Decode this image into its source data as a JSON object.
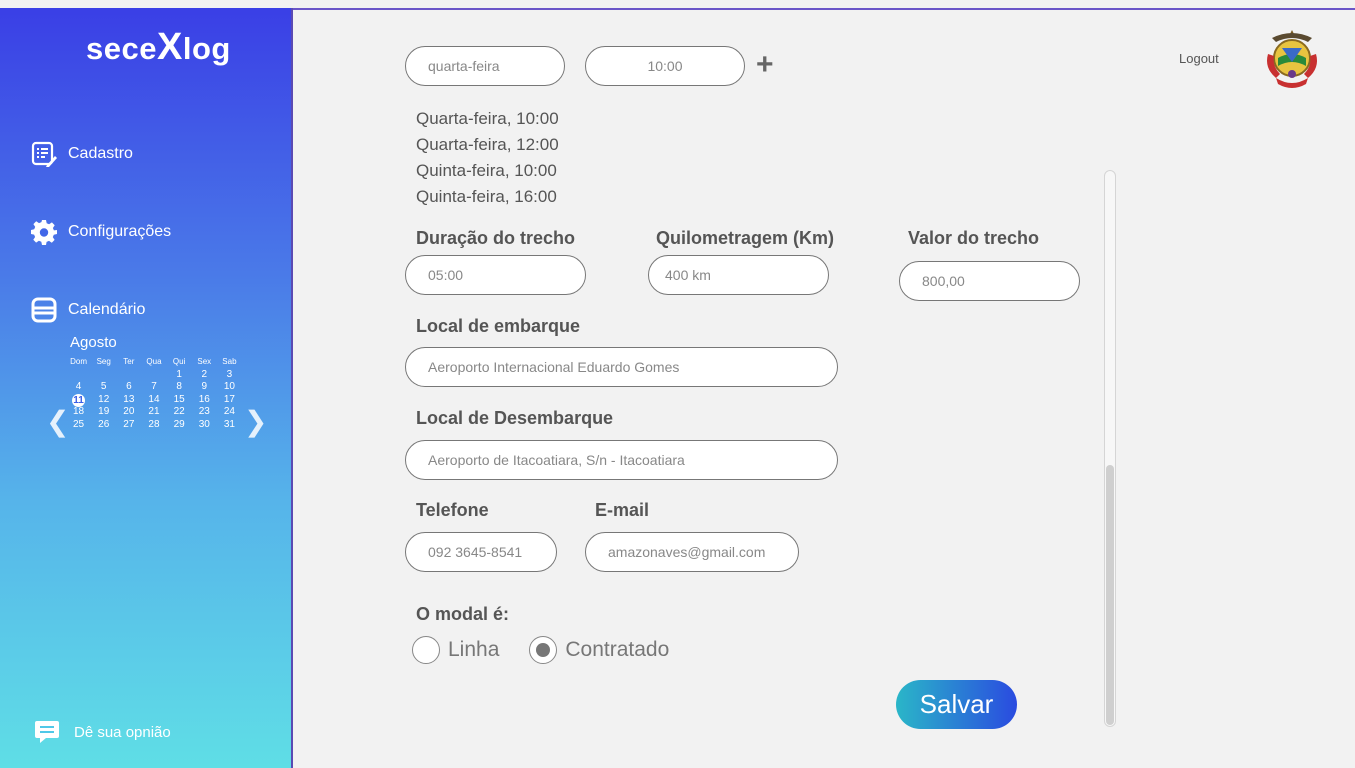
{
  "sidebar": {
    "logo_prefix": "sece",
    "logo_x": "X",
    "logo_suffix": "log",
    "cadastro": "Cadastro",
    "configuracoes": "Configurações",
    "calendario": "Calendário",
    "feedback": "Dê sua opnião"
  },
  "calendar": {
    "month": "Agosto",
    "weekdays": [
      "Dom",
      "Seg",
      "Ter",
      "Qua",
      "Qui",
      "Sex",
      "Sab"
    ],
    "weeks": [
      [
        "",
        "",
        "",
        "",
        "1",
        "2",
        "3"
      ],
      [
        "4",
        "5",
        "6",
        "7",
        "8",
        "9",
        "10"
      ],
      [
        "11",
        "12",
        "13",
        "14",
        "15",
        "16",
        "17"
      ],
      [
        "18",
        "19",
        "20",
        "21",
        "22",
        "23",
        "24"
      ],
      [
        "25",
        "26",
        "27",
        "28",
        "29",
        "30",
        "31"
      ]
    ],
    "today": "11",
    "prev_arrow": "❮",
    "next_arrow": "❯"
  },
  "schedule": {
    "day_value": "quarta-feira",
    "time_value": "10:00",
    "add_symbol": "+",
    "entries": [
      "Quarta-feira, 10:00",
      "Quarta-feira, 12:00",
      "Quinta-feira, 10:00",
      "Quinta-feira, 16:00"
    ]
  },
  "form": {
    "duracao_label": "Duração do trecho",
    "duracao_value": "05:00",
    "quilometragem_label": "Quilometragem (Km)",
    "quilometragem_value": "400 km",
    "valor_label": "Valor do trecho",
    "valor_value": "800,00",
    "embarque_label": "Local de embarque",
    "embarque_value": "Aeroporto Internacional Eduardo Gomes",
    "desembarque_label": "Local de Desembarque",
    "desembarque_value": "Aeroporto de Itacoatiara, S/n - Itacoatiara",
    "telefone_label": "Telefone",
    "telefone_value": "092 3645-8541",
    "email_label": "E-mail",
    "email_value": "amazonaves@gmail.com",
    "modal_label": "O modal é:",
    "modal_options": [
      "Linha",
      "Contratado"
    ],
    "modal_selected": "Contratado",
    "save_label": "Salvar"
  },
  "header": {
    "logout": "Logout"
  },
  "colors": {
    "sidebar_top": "#3a3fe6",
    "sidebar_bottom": "#5fdee6",
    "save_gradient_start": "#2ab6c8",
    "save_gradient_end": "#2a4be0"
  },
  "icons": {
    "cadastro": "clipboard-list-icon",
    "configuracoes": "gear-icon",
    "calendario": "calendar-icon",
    "feedback": "chat-bubble-icon",
    "add": "plus-icon",
    "emblem": "state-emblem-icon"
  }
}
